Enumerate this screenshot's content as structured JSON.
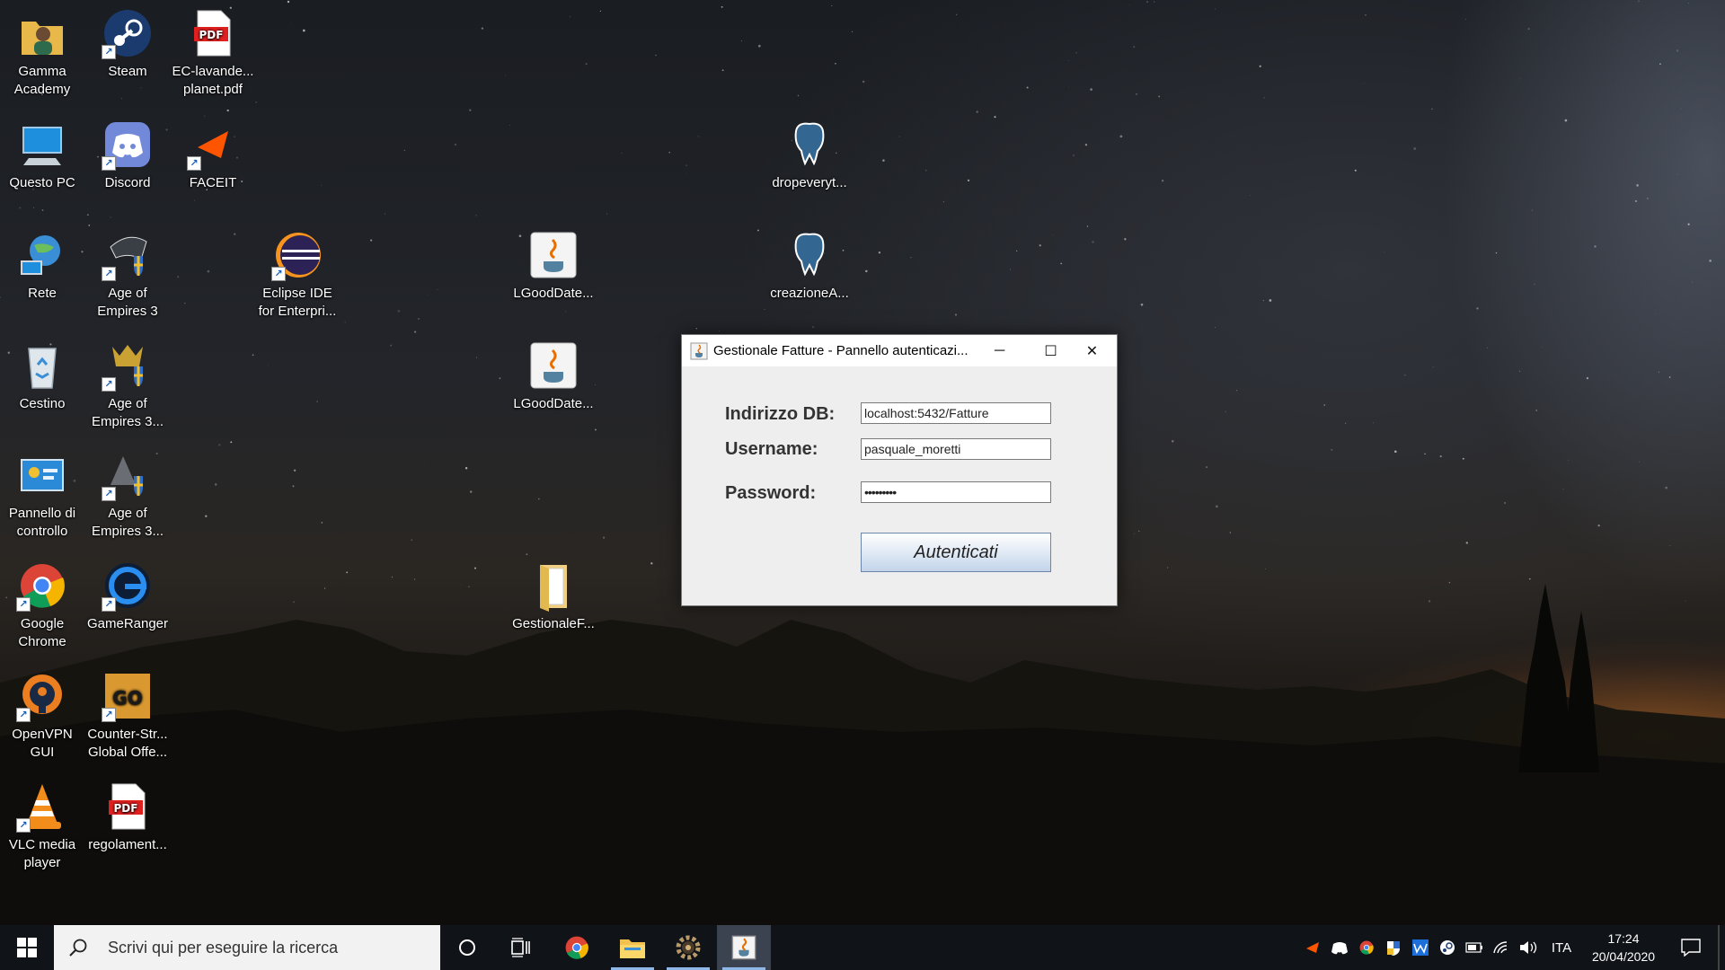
{
  "desktop": {
    "icons": [
      {
        "label": "Gamma Academy",
        "icon": "user-folder-icon"
      },
      {
        "label": "Steam",
        "icon": "steam-icon"
      },
      {
        "label": "EC-lavande... planet.pdf",
        "icon": "pdf-icon"
      },
      {
        "label": "Questo PC",
        "icon": "computer-icon"
      },
      {
        "label": "Discord",
        "icon": "discord-icon"
      },
      {
        "label": "FACEIT",
        "icon": "faceit-icon"
      },
      {
        "label": "Rete",
        "icon": "network-icon"
      },
      {
        "label": "Age of Empires 3",
        "icon": "age-of-empires-icon"
      },
      {
        "label": "Eclipse IDE for Enterpri...",
        "icon": "eclipse-icon"
      },
      {
        "label": "LGoodDate...",
        "icon": "java-jar-icon"
      },
      {
        "label": "dropeveryt...",
        "icon": "postgresql-icon"
      },
      {
        "label": "creazioneA...",
        "icon": "postgresql-icon"
      },
      {
        "label": "Cestino",
        "icon": "recycle-bin-icon"
      },
      {
        "label": "Age of Empires 3...",
        "icon": "age-of-empires-icon"
      },
      {
        "label": "LGoodDate...",
        "icon": "java-jar-icon"
      },
      {
        "label": "Pannello di controllo",
        "icon": "control-panel-icon"
      },
      {
        "label": "Age of Empires 3...",
        "icon": "age-of-empires-icon"
      },
      {
        "label": "Google Chrome",
        "icon": "chrome-icon"
      },
      {
        "label": "GameRanger",
        "icon": "gameranger-icon"
      },
      {
        "label": "GestionaleF...",
        "icon": "folder-icon"
      },
      {
        "label": "OpenVPN GUI",
        "icon": "openvpn-icon"
      },
      {
        "label": "Counter-Str... Global Offe...",
        "icon": "csgo-icon"
      },
      {
        "label": "VLC media player",
        "icon": "vlc-icon"
      },
      {
        "label": "regolament...",
        "icon": "pdf-icon"
      }
    ]
  },
  "dialog": {
    "title": "Gestionale Fatture - Pannello autenticazi...",
    "db_label": "Indirizzo DB:",
    "db_value": "localhost:5432/Fatture",
    "username_label": "Username:",
    "username_value": "pasquale_moretti",
    "password_label": "Password:",
    "password_value": "•••••••••",
    "submit_label": "Autenticati",
    "controls": {
      "minimize": "─",
      "maximize": "☐",
      "close": "✕"
    }
  },
  "taskbar": {
    "search_placeholder": "Scrivi qui per eseguire la ricerca",
    "pinned": [
      "cortana-icon",
      "task-view-icon",
      "chrome-icon",
      "file-explorer-icon",
      "gear-app-icon",
      "java-app-icon"
    ],
    "tray": {
      "language": "ITA",
      "time": "17:24",
      "date": "20/04/2020"
    }
  },
  "colors": {
    "taskbar_bg": "#101317",
    "dialog_bg": "#eeeeee",
    "button_accent": "#c2d4ea"
  }
}
